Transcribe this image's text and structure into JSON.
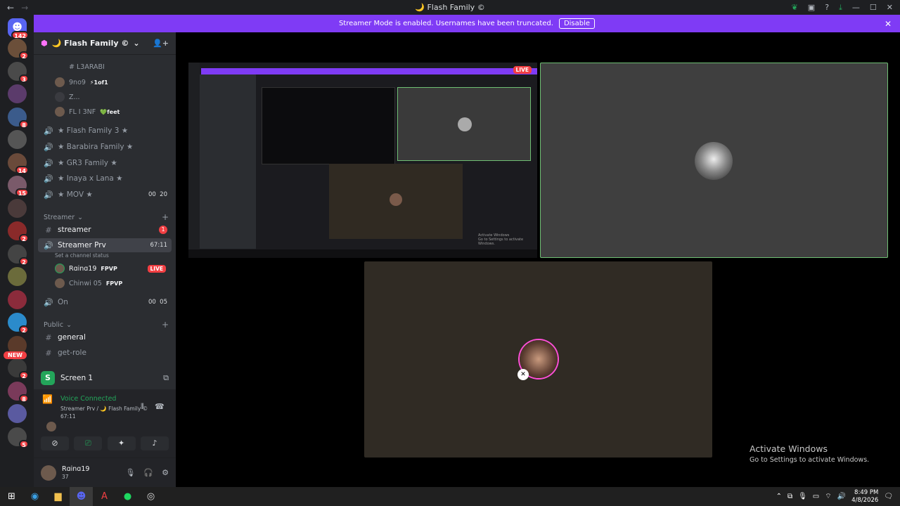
{
  "window": {
    "title": "🌙 Flash Family ©",
    "back": "←",
    "forward": "→"
  },
  "banner": {
    "text": "Streamer Mode is enabled. Usernames have been truncated.",
    "disable_label": "Disable",
    "close": "✕"
  },
  "guilds": {
    "home_badge": "142",
    "badges": [
      "2",
      "3",
      "",
      "8",
      "",
      "14",
      "15",
      "",
      "2",
      "2",
      "",
      "",
      "2",
      "",
      "2",
      "8",
      "",
      "5"
    ],
    "new_label": "NEW"
  },
  "server": {
    "name": "🌙 Flash Family ©",
    "chevron": "⌄"
  },
  "channels": {
    "top_users": [
      {
        "name": "# L3ARABI",
        "tag": ""
      },
      {
        "name": "9no9",
        "tag": "⚡1of1"
      },
      {
        "name": "Z...",
        "tag": ""
      },
      {
        "name": "FL I 3NF",
        "tag": "💚feet"
      }
    ],
    "voice": [
      {
        "name": "★ Flash Family 3 ★"
      },
      {
        "name": "★ Barabira Family ★"
      },
      {
        "name": "★ GR3 Family ★"
      },
      {
        "name": "★ Inaya x Lana ★"
      },
      {
        "name": "★ MOV ★",
        "count_a": "00",
        "count_b": "20"
      }
    ],
    "streamer_category": "Streamer",
    "streamer_text": {
      "name": "streamer",
      "badge": "1"
    },
    "streamer_prv": {
      "name": "Streamer Prv",
      "time": "67:11",
      "status": "Set a channel status"
    },
    "streamer_users": [
      {
        "name": "Rɑinɑ19",
        "tag": "FPVP",
        "live": "LIVE"
      },
      {
        "name": "Chinwi 05",
        "tag": "FPVP",
        "live": ""
      }
    ],
    "on_channel": {
      "name": "On",
      "count_a": "00",
      "count_b": "05"
    },
    "public_category": "Public",
    "public": [
      {
        "name": "general"
      },
      {
        "name": "get-role"
      }
    ]
  },
  "voice_panel": {
    "screen_label": "Screen 1",
    "connected": "Voice Connected",
    "path": "Streamer Prv / 🌙 Flash Family ©",
    "time": "67:11"
  },
  "user": {
    "name": "Rɑinɑ19",
    "status": "37"
  },
  "nested": {
    "live": "LIVE",
    "activate_1": "Activate Windows",
    "activate_2": "Go to Settings to activate Windows."
  },
  "activate": {
    "line1": "Activate Windows",
    "line2": "Go to Settings to activate Windows."
  },
  "clock": {
    "time": "8:49 PM",
    "date": "4/8/2026"
  },
  "colors": {
    "accent": "#7f3bf5",
    "live": "#f23f43",
    "green": "#23a55a",
    "speaking": "#6fbf73"
  }
}
